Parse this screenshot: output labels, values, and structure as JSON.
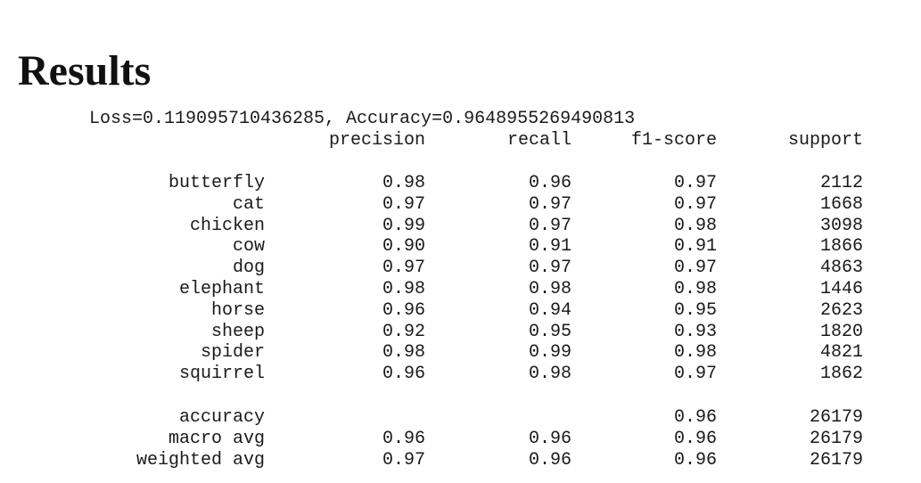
{
  "title": "Results",
  "summary": "Loss=0.119095710436285, Accuracy=0.9648955269490813",
  "headers": {
    "precision": "precision",
    "recall": "recall",
    "f1": "f1-score",
    "support": "support"
  },
  "rows": [
    {
      "label": "butterfly",
      "precision": "0.98",
      "recall": "0.96",
      "f1": "0.97",
      "support": "2112"
    },
    {
      "label": "cat",
      "precision": "0.97",
      "recall": "0.97",
      "f1": "0.97",
      "support": "1668"
    },
    {
      "label": "chicken",
      "precision": "0.99",
      "recall": "0.97",
      "f1": "0.98",
      "support": "3098"
    },
    {
      "label": "cow",
      "precision": "0.90",
      "recall": "0.91",
      "f1": "0.91",
      "support": "1866"
    },
    {
      "label": "dog",
      "precision": "0.97",
      "recall": "0.97",
      "f1": "0.97",
      "support": "4863"
    },
    {
      "label": "elephant",
      "precision": "0.98",
      "recall": "0.98",
      "f1": "0.98",
      "support": "1446"
    },
    {
      "label": "horse",
      "precision": "0.96",
      "recall": "0.94",
      "f1": "0.95",
      "support": "2623"
    },
    {
      "label": "sheep",
      "precision": "0.92",
      "recall": "0.95",
      "f1": "0.93",
      "support": "1820"
    },
    {
      "label": "spider",
      "precision": "0.98",
      "recall": "0.99",
      "f1": "0.98",
      "support": "4821"
    },
    {
      "label": "squirrel",
      "precision": "0.96",
      "recall": "0.98",
      "f1": "0.97",
      "support": "1862"
    }
  ],
  "summary_rows": [
    {
      "label": "accuracy",
      "precision": "",
      "recall": "",
      "f1": "0.96",
      "support": "26179"
    },
    {
      "label": "macro avg",
      "precision": "0.96",
      "recall": "0.96",
      "f1": "0.96",
      "support": "26179"
    },
    {
      "label": "weighted avg",
      "precision": "0.97",
      "recall": "0.96",
      "f1": "0.96",
      "support": "26179"
    }
  ]
}
